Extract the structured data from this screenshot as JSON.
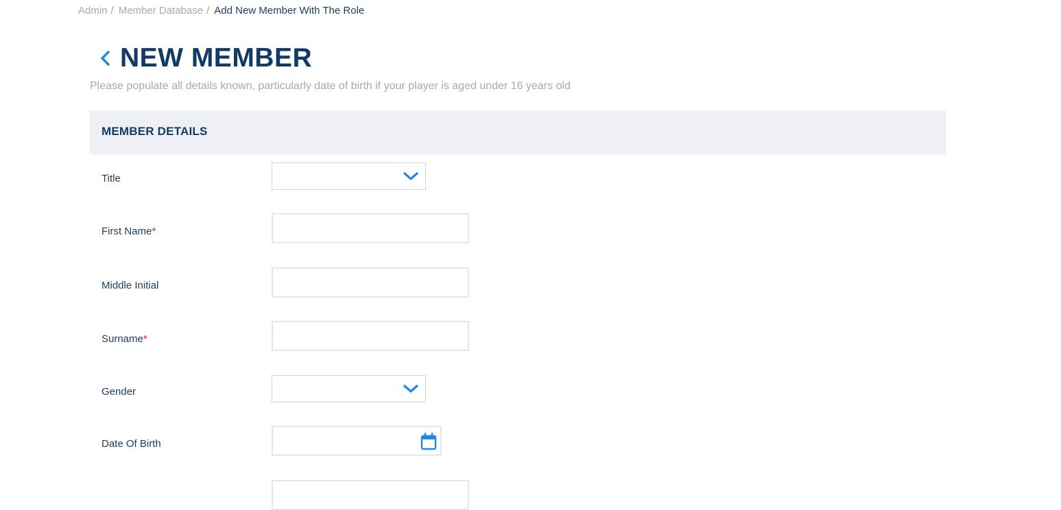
{
  "breadcrumb": {
    "items": [
      "Admin",
      "Member Database",
      "Add New Member With The Role"
    ],
    "separator": "/"
  },
  "header": {
    "title": "NEW MEMBER",
    "subtitle": "Please populate all details known, particularly date of birth if your player is aged under 16 years old"
  },
  "section": {
    "title": "MEMBER DETAILS"
  },
  "fields": {
    "title": {
      "label": "Title",
      "value": "",
      "required": false
    },
    "first_name": {
      "label": "First Name",
      "value": "",
      "required": true
    },
    "middle_initial": {
      "label": "Middle Initial",
      "value": "",
      "required": false
    },
    "surname": {
      "label": "Surname",
      "value": "",
      "required": true
    },
    "gender": {
      "label": "Gender",
      "value": "",
      "required": false
    },
    "date_of_birth": {
      "label": "Date Of Birth",
      "value": "",
      "required": false
    }
  },
  "required_marker": "*",
  "colors": {
    "accent": "#1e88e5",
    "title": "#0f3b66",
    "required": "#e0212f",
    "section_bg": "#eff0f5"
  }
}
